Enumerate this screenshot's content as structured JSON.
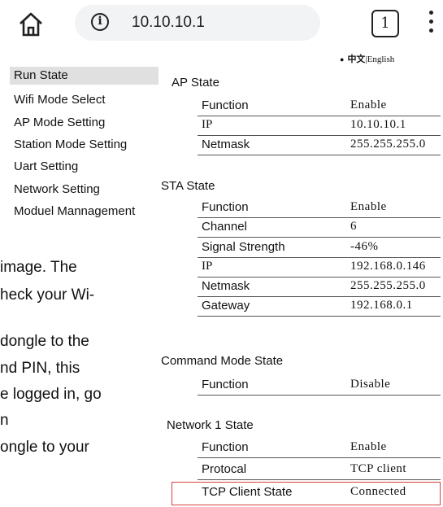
{
  "browser": {
    "url": "10.10.10.1",
    "tab_count": "1"
  },
  "language": {
    "zh": "中文",
    "sep": "|",
    "en": "English"
  },
  "sidebar": {
    "items": [
      {
        "label": "Run State"
      },
      {
        "label": "Wifi Mode Select"
      },
      {
        "label": "AP Mode Setting"
      },
      {
        "label": "Station Mode Setting"
      },
      {
        "label": "Uart Setting"
      },
      {
        "label": "Network Setting"
      },
      {
        "label": "Moduel Mannagement"
      }
    ]
  },
  "background_text": [
    "image. The",
    "heck your Wi-",
    "dongle to the",
    "nd PIN, this",
    "e logged in, go",
    "n",
    "ongle to your"
  ],
  "sections": {
    "ap": {
      "title": "AP State",
      "rows": [
        {
          "key": "Function",
          "value": "Enable"
        },
        {
          "key": "IP",
          "value": "10.10.10.1"
        },
        {
          "key": "Netmask",
          "value": "255.255.255.0"
        }
      ]
    },
    "sta": {
      "title": "STA State",
      "rows": [
        {
          "key": "Function",
          "value": "Enable"
        },
        {
          "key": "Channel",
          "value": "6"
        },
        {
          "key": "Signal Strength",
          "value": "-46%"
        },
        {
          "key": "IP",
          "value": "192.168.0.146"
        },
        {
          "key": "Netmask",
          "value": "255.255.255.0"
        },
        {
          "key": "Gateway",
          "value": "192.168.0.1"
        }
      ]
    },
    "cmd": {
      "title": "Command Mode State",
      "rows": [
        {
          "key": "Function",
          "value": "Disable"
        }
      ]
    },
    "net1": {
      "title": "Network 1 State",
      "rows": [
        {
          "key": "Function",
          "value": "Enable"
        },
        {
          "key": "Protocal",
          "value": "TCP client"
        },
        {
          "key": "TCP Client State",
          "value": "Connected"
        }
      ]
    }
  },
  "colors": {
    "highlight_border": "#d84040",
    "active_item_bg": "#e0e0e0",
    "url_bar_bg": "#f1f3f4"
  }
}
